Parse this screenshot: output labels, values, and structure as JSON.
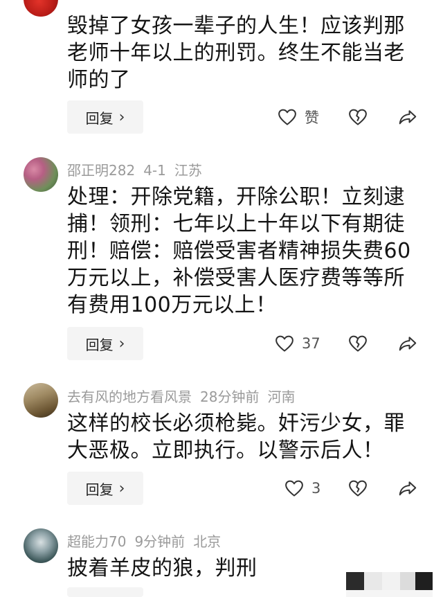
{
  "comments": [
    {
      "user": "",
      "date": "",
      "location": "",
      "text": "毁掉了女孩一辈子的人生！应该判那老师十年以上的刑罚。终生不能当老师的了",
      "reply_label": "回复",
      "likes": "赞"
    },
    {
      "user": "邵正明282",
      "date": "4-1",
      "location": "江苏",
      "text": "处理：开除党籍，开除公职！立刻逮捕！领刑：七年以上十年以下有期徒刑！赔偿：赔偿受害者精神损失费60万元以上，补偿受害人医疗费等等所有费用100万元以上！",
      "reply_label": "回复",
      "likes": "37"
    },
    {
      "user": "去有风的地方看风景",
      "date": "28分钟前",
      "location": "河南",
      "text": "这样的校长必须枪毙。奸污少女，罪大恶极。立即执行。以警示后人！",
      "reply_label": "回复",
      "likes": "3"
    },
    {
      "user": "超能力70",
      "date": "9分钟前",
      "location": "北京",
      "text": "披着羊皮的狼，判刑",
      "reply_label": "",
      "likes": ""
    }
  ],
  "colors": {
    "meta": "#9a9a9a",
    "text": "#141414",
    "reply_bg": "#f4f4f4",
    "icon": "#333333"
  },
  "icons": [
    "heart-icon",
    "broken-heart-icon",
    "share-icon",
    "chevron-right-icon"
  ]
}
